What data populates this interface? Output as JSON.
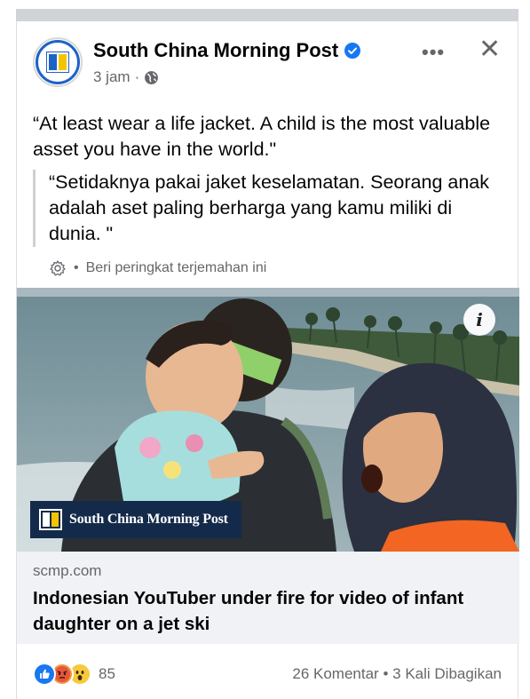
{
  "post": {
    "page_name": "South China Morning Post",
    "time": "3 jam",
    "separator": "·",
    "text": "“At least wear a life jacket. A child is the most valuable asset you have in the world.\"",
    "translation": "“Setidaknya pakai jaket keselamatan. Seorang anak adalah aset paling berharga yang kamu miliki di dunia. \"",
    "translation_rating_bullet": "•",
    "translation_rating": "Beri peringkat terjemahan ini"
  },
  "media": {
    "watermark": "South China Morning Post",
    "info_glyph": "i"
  },
  "link": {
    "domain": "scmp.com",
    "title": "Indonesian YouTuber under fire for video of infant daughter on a jet ski"
  },
  "footer": {
    "reaction_count": "85",
    "comments": "26 Komentar",
    "bullet": "•",
    "shares": "3 Kali Dibagikan"
  },
  "icons": [
    "verified-icon",
    "globe-icon",
    "more-icon",
    "close-icon",
    "gear-icon",
    "info-icon",
    "like-reaction-icon",
    "angry-reaction-icon",
    "wow-reaction-icon"
  ],
  "colors": {
    "brand_blue": "#1d63c7",
    "brand_yellow": "#f5c400",
    "watermark_bg": "#142a4a",
    "facebook_blue": "#1877f2",
    "secondary_text": "#65676b"
  }
}
